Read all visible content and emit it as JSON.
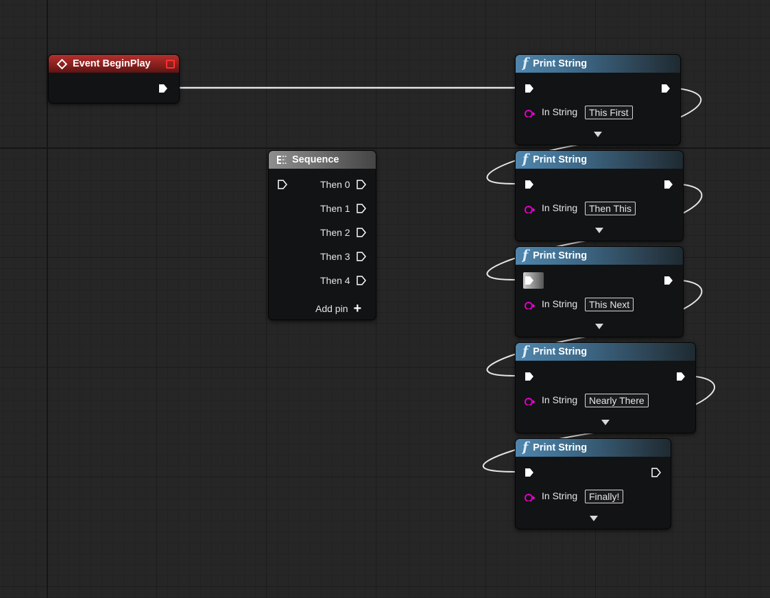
{
  "event_node": {
    "title": "Event BeginPlay",
    "icon": "event-diamond-icon",
    "accent": "#b3302d"
  },
  "sequence_node": {
    "title": "Sequence",
    "icon": "sequence-icon",
    "outputs": [
      "Then 0",
      "Then 1",
      "Then 2",
      "Then 3",
      "Then 4"
    ],
    "add_pin_label": "Add pin"
  },
  "print_nodes": [
    {
      "title": "Print String",
      "param_label": "In String",
      "value": "This First"
    },
    {
      "title": "Print String",
      "param_label": "In String",
      "value": "Then This"
    },
    {
      "title": "Print String",
      "param_label": "In String",
      "value": "This Next"
    },
    {
      "title": "Print String",
      "param_label": "In String",
      "value": "Nearly There"
    },
    {
      "title": "Print String",
      "param_label": "In String",
      "value": "Finally!"
    }
  ],
  "colors": {
    "string_pin": "#e000c8",
    "function_header": "#4f86ad",
    "sequence_header": "#8e8e8e"
  }
}
